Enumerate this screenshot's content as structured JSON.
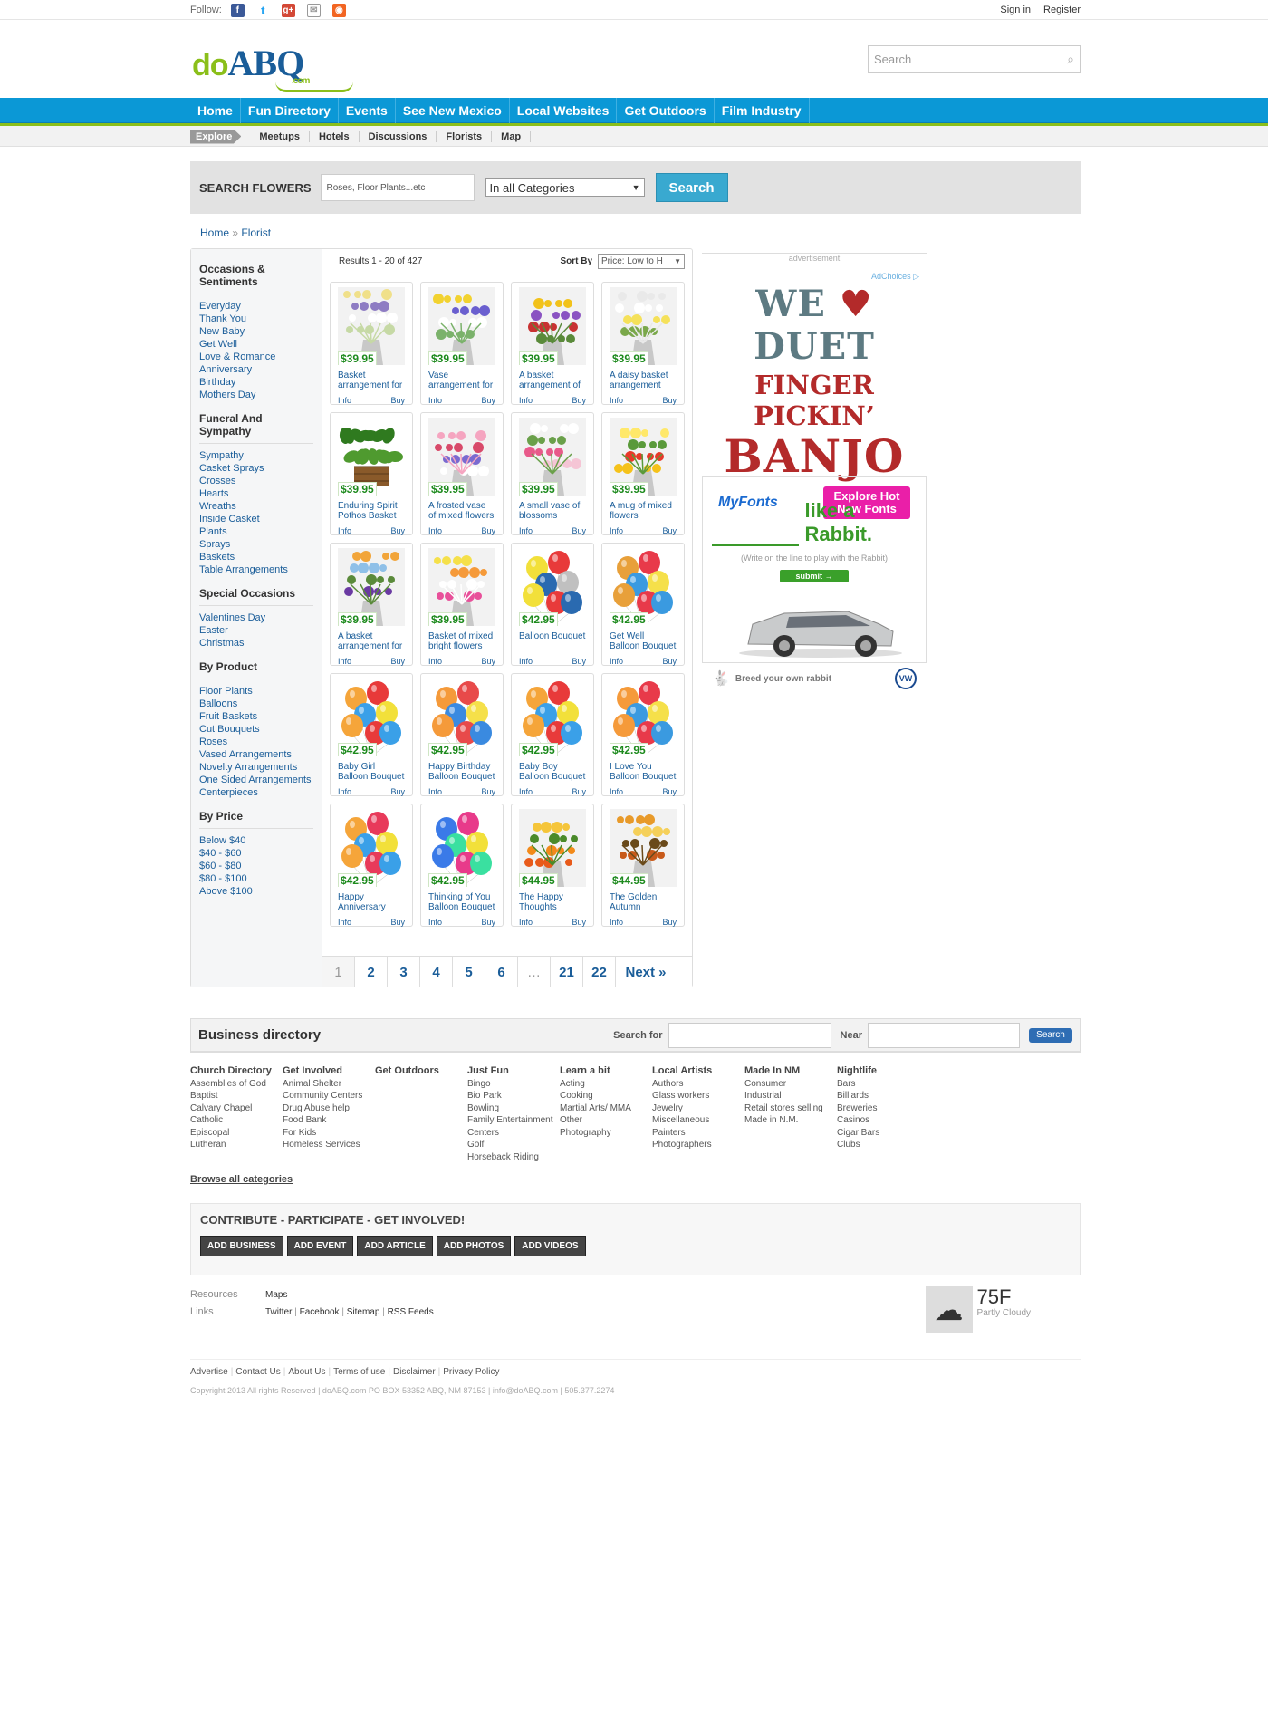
{
  "topbar": {
    "follow": "Follow:",
    "signin": "Sign in",
    "register": "Register",
    "social": [
      "facebook-icon",
      "twitter-icon",
      "googleplus-icon",
      "email-icon",
      "rss-icon"
    ]
  },
  "header": {
    "logo_do": "do",
    "logo_abq": "ABQ",
    "logo_com": ".com",
    "search_placeholder": "Search"
  },
  "mainnav": [
    "Home",
    "Fun Directory",
    "Events",
    "See New Mexico",
    "Local Websites",
    "Get Outdoors",
    "Film Industry"
  ],
  "subnav": {
    "explore": "Explore",
    "items": [
      "Meetups",
      "Hotels",
      "Discussions",
      "Florists",
      "Map"
    ]
  },
  "searchbar": {
    "label": "SEARCH FLOWERS",
    "placeholder": "Roses, Floor Plants...etc",
    "category": "In all Categories",
    "button": "Search"
  },
  "breadcrumb": {
    "home": "Home",
    "sep": "»",
    "current": "Florist"
  },
  "sidebar": [
    {
      "title": "Occasions & Sentiments",
      "items": [
        "Everyday",
        "Thank You",
        "New Baby",
        "Get Well",
        "Love & Romance",
        "Anniversary",
        "Birthday",
        "Mothers Day"
      ]
    },
    {
      "title": "Funeral And Sympathy",
      "items": [
        "Sympathy",
        "Casket Sprays",
        "Crosses",
        "Hearts",
        "Wreaths",
        "Inside Casket",
        "Plants",
        "Sprays",
        "Baskets",
        "Table Arrangements"
      ]
    },
    {
      "title": "Special Occasions",
      "items": [
        "Valentines Day",
        "Easter",
        "Christmas"
      ]
    },
    {
      "title": "By Product",
      "items": [
        "Floor Plants",
        "Balloons",
        "Fruit Baskets",
        "Cut Bouquets",
        "Roses",
        "Vased Arrangements",
        "Novelty Arrangements",
        "One Sided Arrangements",
        "Centerpieces"
      ]
    },
    {
      "title": "By Price",
      "items": [
        "Below $40",
        "$40 - $60",
        "$60 - $80",
        "$80 - $100",
        "Above $100"
      ]
    }
  ],
  "results": {
    "count": "Results 1 - 20 of 427",
    "sort_label": "Sort By",
    "sort_value": "Price: Low to H",
    "info": "Info",
    "buy": "Buy",
    "products": [
      {
        "price": "$39.95",
        "name": "Basket arrangement for a",
        "kind": "flowers",
        "c": [
          "#f0e08a",
          "#8e7cc3",
          "#ffffff",
          "#c6d9a5"
        ]
      },
      {
        "price": "$39.95",
        "name": "Vase arrangement for baby boy",
        "kind": "flowers",
        "c": [
          "#f2d230",
          "#6a5fcf",
          "#ffffff",
          "#7bb26b"
        ]
      },
      {
        "price": "$39.95",
        "name": "A basket arrangement of",
        "kind": "flowers",
        "c": [
          "#f2c21a",
          "#8a53c2",
          "#c83232",
          "#5a8a3a"
        ]
      },
      {
        "price": "$39.95",
        "name": "A daisy basket arrangement",
        "kind": "flowers",
        "c": [
          "#ffffff",
          "#f5e15a",
          "#7aa84a",
          "#e9e9e9"
        ]
      },
      {
        "price": "$39.95",
        "name": "Enduring Spirit Pothos Basket",
        "kind": "plant",
        "c": [
          "#2f7a1f",
          "#4f9a2f",
          "#8a5a2a",
          "#1f5a15"
        ]
      },
      {
        "price": "$39.95",
        "name": "A frosted vase of mixed flowers",
        "kind": "flowers",
        "c": [
          "#d84a6a",
          "#7a6ad0",
          "#ffffff",
          "#f5a5c0"
        ]
      },
      {
        "price": "$39.95",
        "name": "A small vase of blossoms",
        "kind": "flowers",
        "c": [
          "#e85a8a",
          "#f5c5d5",
          "#ffffff",
          "#6aa04a"
        ]
      },
      {
        "price": "$39.95",
        "name": "A mug of mixed flowers",
        "kind": "flowers",
        "c": [
          "#e8392a",
          "#f5c21a",
          "#ffe86a",
          "#5a9a3a"
        ]
      },
      {
        "price": "$39.95",
        "name": "A basket arrangement for a",
        "kind": "flowers",
        "c": [
          "#6a3aa2",
          "#f2a53a",
          "#8fc0e8",
          "#5a8a3a"
        ]
      },
      {
        "price": "$39.95",
        "name": "Basket of mixed bright flowers",
        "kind": "flowers",
        "c": [
          "#e8509a",
          "#f5e04a",
          "#f59a3a",
          "#ffffff"
        ]
      },
      {
        "price": "$42.95",
        "name": "Balloon Bouquet",
        "kind": "balloons",
        "c": [
          "#f2e03a",
          "#e83a3a",
          "#2a6ab0",
          "#c0c0c0"
        ]
      },
      {
        "price": "$42.95",
        "name": "Get Well Balloon Bouquet",
        "kind": "balloons",
        "c": [
          "#e8a03a",
          "#e83a4a",
          "#3a9ae0",
          "#f5e04a"
        ]
      },
      {
        "price": "$42.95",
        "name": "Baby Girl Balloon Bouquet",
        "kind": "balloons",
        "c": [
          "#f5a53a",
          "#e83a3a",
          "#3aa0e8",
          "#f2e03a"
        ]
      },
      {
        "price": "$42.95",
        "name": "Happy Birthday Balloon Bouquet",
        "kind": "balloons",
        "c": [
          "#f59a3a",
          "#e84a4a",
          "#3a8ae0",
          "#f5e04a"
        ]
      },
      {
        "price": "$42.95",
        "name": "Baby Boy Balloon Bouquet",
        "kind": "balloons",
        "c": [
          "#f5a53a",
          "#e83a3a",
          "#3aa0e8",
          "#f2e03a"
        ]
      },
      {
        "price": "$42.95",
        "name": "I Love You Balloon Bouquet",
        "kind": "balloons",
        "c": [
          "#f59a3a",
          "#e83a4a",
          "#3a9ae0",
          "#f5e04a"
        ]
      },
      {
        "price": "$42.95",
        "name": "Happy Anniversary",
        "kind": "balloons",
        "c": [
          "#f5a53a",
          "#e83a5a",
          "#3aa0e8",
          "#f2e03a"
        ]
      },
      {
        "price": "$42.95",
        "name": "Thinking of You Balloon Bouquet",
        "kind": "balloons",
        "c": [
          "#3a7ae8",
          "#e83a8a",
          "#3ae0a0",
          "#f2e03a"
        ]
      },
      {
        "price": "$44.95",
        "name": "The Happy Thoughts Bouquet",
        "kind": "flowers",
        "c": [
          "#f28a1a",
          "#e85a1a",
          "#f5c53a",
          "#4a8a2a"
        ]
      },
      {
        "price": "$44.95",
        "name": "The Golden Autumn Bouquet",
        "kind": "flowers",
        "c": [
          "#c85a1a",
          "#e89a2a",
          "#f5d05a",
          "#6a4a1a"
        ]
      }
    ]
  },
  "pager": {
    "pages": [
      "1",
      "2",
      "3",
      "4",
      "5",
      "6",
      "…",
      "21",
      "22"
    ],
    "next": "Next »",
    "current": "1"
  },
  "ads": {
    "label": "advertisement",
    "adchoices": "AdChoices",
    "ad1": {
      "line1a": "WE",
      "line1b": "DUET",
      "line2": "FINGER PICKIN’",
      "line3": "BANJO",
      "brand": "MyFonts",
      "cta": "Explore Hot New Fonts"
    },
    "ad2": {
      "headline": "like a Rabbit.",
      "sub": "(Write on the line to play with the Rabbit)",
      "submit": "submit →",
      "tagline": "Breed your own rabbit",
      "logo": "VW"
    }
  },
  "bizdir": {
    "title": "Business directory",
    "search_for": "Search for",
    "near": "Near",
    "button": "Search"
  },
  "dircols": [
    {
      "h": "Church Directory",
      "items": [
        "Assemblies of God",
        "Baptist",
        "Calvary Chapel",
        "Catholic",
        "Episcopal",
        "Lutheran"
      ]
    },
    {
      "h": "Get Involved",
      "items": [
        "Animal Shelter",
        "Community Centers",
        "Drug Abuse help",
        "Food Bank",
        "For Kids",
        "Homeless Services"
      ]
    },
    {
      "h": "Get Outdoors",
      "items": []
    },
    {
      "h": "Just Fun",
      "items": [
        "Bingo",
        "Bio Park",
        "Bowling",
        "Family Entertainment",
        "Centers",
        "Golf",
        "Horseback Riding"
      ]
    },
    {
      "h": "Learn a bit",
      "items": [
        "Acting",
        "Cooking",
        "Martial Arts/ MMA",
        "Other",
        "Photography"
      ]
    },
    {
      "h": "Local Artists",
      "items": [
        "Authors",
        "Glass workers",
        "Jewelry",
        "Miscellaneous",
        "Painters",
        "Photographers"
      ]
    },
    {
      "h": "Made In NM",
      "items": [
        "Consumer",
        "Industrial",
        "Retail stores selling",
        "Made in N.M."
      ]
    },
    {
      "h": "Nightlife",
      "items": [
        "Bars",
        "Billiards",
        "Breweries",
        "Casinos",
        "Cigar Bars",
        "Clubs"
      ]
    }
  ],
  "browse_all": "Browse all categories",
  "contribute": {
    "title": "CONTRIBUTE - PARTICIPATE - GET INVOLVED!",
    "buttons": [
      "ADD BUSINESS",
      "ADD EVENT",
      "ADD ARTICLE",
      "ADD PHOTOS",
      "ADD VIDEOS"
    ]
  },
  "links": {
    "resources": "Resources",
    "links": "Links",
    "maps": "Maps",
    "twitter": "Twitter",
    "facebook": "Facebook",
    "sitemap": "Sitemap",
    "rss": "RSS Feeds",
    "sep": "|"
  },
  "weather": {
    "temp": "75F",
    "cond": "Partly Cloudy",
    "icon": "cloud-icon"
  },
  "footer": {
    "links": [
      "Advertise",
      "Contact Us",
      "About Us",
      "Terms of use",
      "Disclaimer",
      "Privacy Policy"
    ],
    "copyright": "Copyright 2013 All rights Reserved | doABQ.com PO BOX 53352 ABQ, NM 87153 | info@doABQ.com | 505.377.2274"
  }
}
